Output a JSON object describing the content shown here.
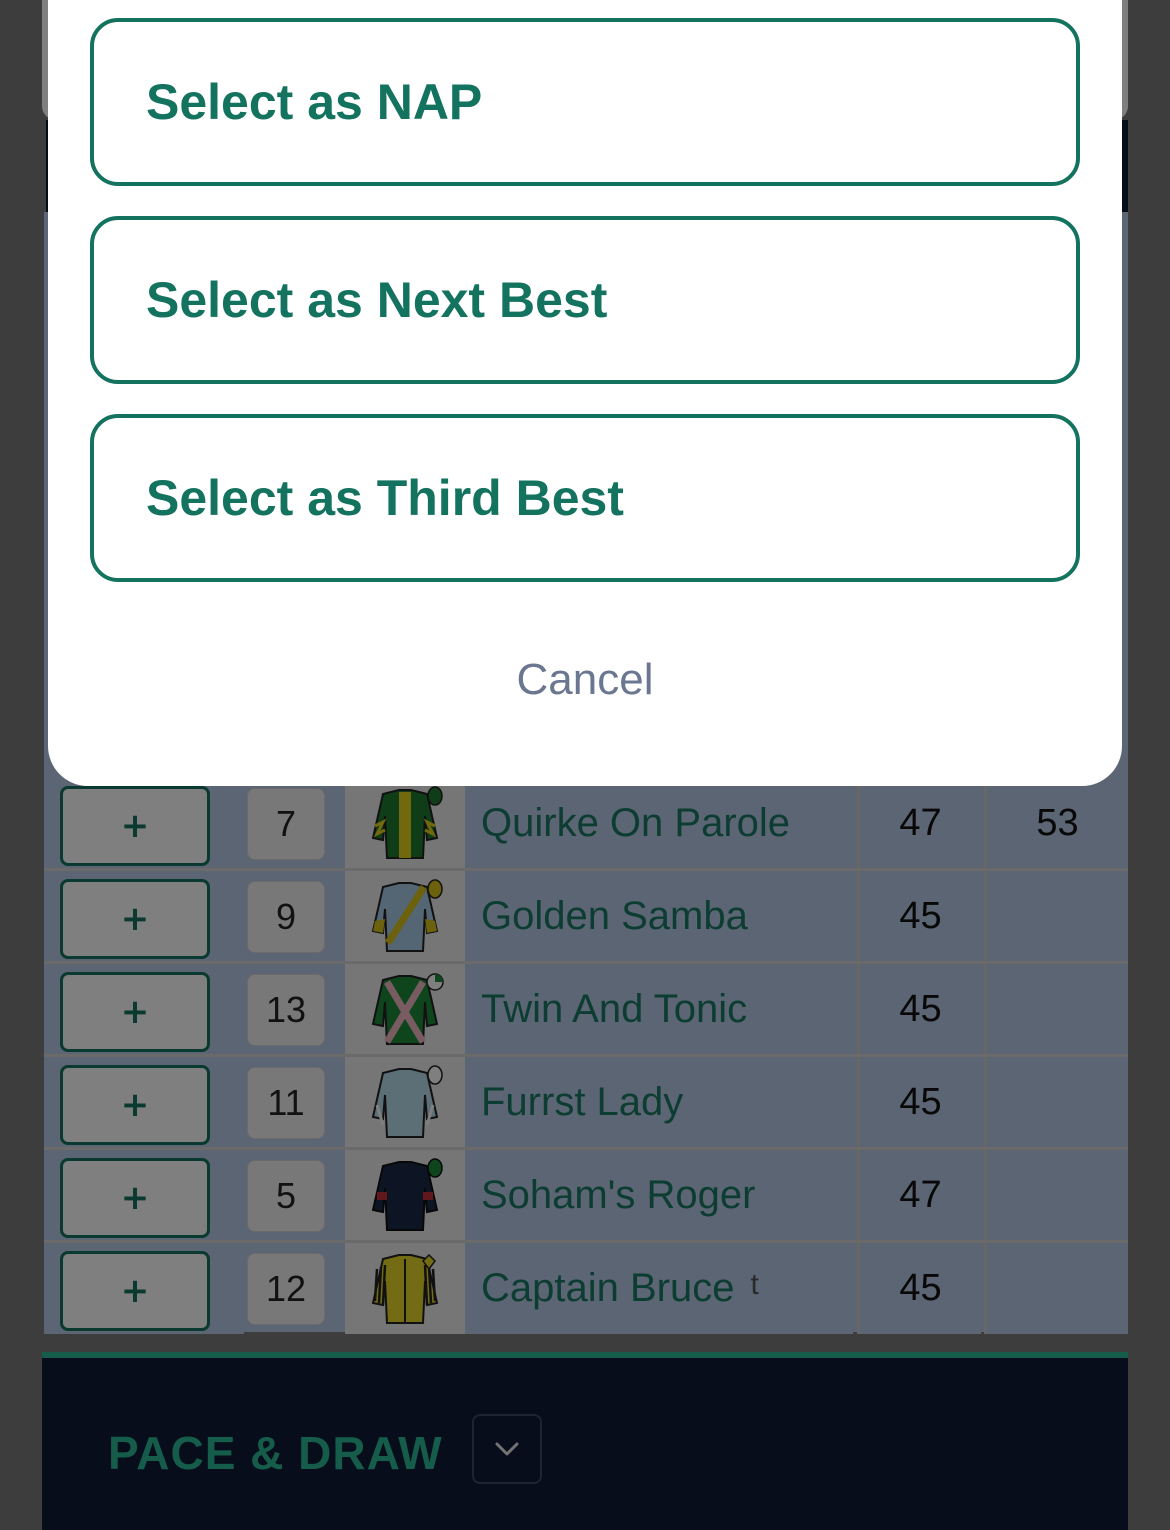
{
  "action_sheet": {
    "options": [
      {
        "label": "Select as NAP"
      },
      {
        "label": "Select as Next Best"
      },
      {
        "label": "Select as Third Best"
      }
    ],
    "cancel_label": "Cancel"
  },
  "runners": [
    {
      "plus": "+",
      "number": "7",
      "name": "Quirke On Parole",
      "tag": "",
      "col_a": "47",
      "col_b": "53",
      "silk": "green-yellow-stripe-silk-icon"
    },
    {
      "plus": "+",
      "number": "9",
      "name": "Golden Samba",
      "tag": "",
      "col_a": "45",
      "col_b": "",
      "silk": "lightblue-yellow-sash-silk-icon"
    },
    {
      "plus": "+",
      "number": "13",
      "name": "Twin And Tonic",
      "tag": "",
      "col_a": "45",
      "col_b": "",
      "silk": "green-pink-cross-silk-icon"
    },
    {
      "plus": "+",
      "number": "11",
      "name": "Furrst Lady",
      "tag": "",
      "col_a": "45",
      "col_b": "",
      "silk": "lightblue-silk-icon"
    },
    {
      "plus": "+",
      "number": "5",
      "name": "Soham's Roger",
      "tag": "",
      "col_a": "47",
      "col_b": "",
      "silk": "navy-red-green-silk-icon"
    },
    {
      "plus": "+",
      "number": "12",
      "name": "Captain Bruce",
      "tag": "t",
      "col_a": "45",
      "col_b": "",
      "silk": "yellow-black-stripe-silk-icon"
    }
  ],
  "section": {
    "title": "PACE & DRAW",
    "toggle_icon": "chevron-down-icon"
  },
  "colors": {
    "brand_green": "#14735f",
    "accent_teal": "#2ab894",
    "navy": "#0e1a35",
    "row_blue": "#b6cbe6"
  }
}
